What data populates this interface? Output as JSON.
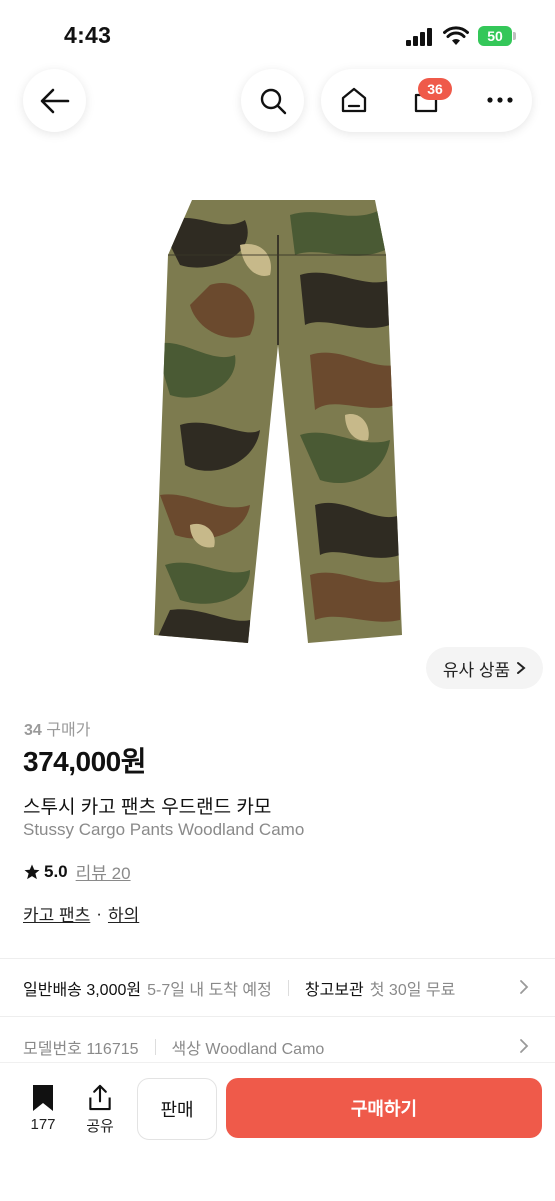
{
  "status_bar": {
    "time": "4:43",
    "battery": "50"
  },
  "nav": {
    "cart_count": "36"
  },
  "product": {
    "similar_label": "유사 상품",
    "purchase_count": "34",
    "purchase_suffix": "구매가",
    "price": "374,000원",
    "name_ko": "스투시 카고 팬츠 우드랜드 카모",
    "name_en": "Stussy Cargo Pants Woodland Camo",
    "rating": "5.0",
    "review_label": "리뷰 20",
    "category_1": "카고 팬츠",
    "category_sep": "·",
    "category_2": "하의"
  },
  "shipping": {
    "label": "일반배송 3,000원",
    "eta": "5-7일 내 도착 예정",
    "storage_label": "창고보관",
    "storage_offer": "첫 30일 무료"
  },
  "details": {
    "model": "모델번호 116715",
    "color": "색상 Woodland Camo"
  },
  "bottom_bar": {
    "bookmark_count": "177",
    "share_label": "공유",
    "sell_label": "판매",
    "buy_label": "구매하기"
  },
  "colors": {
    "accent": "#ef5a4a",
    "camo_base": "#7a7a4e",
    "camo_dark": "#2f2b22",
    "camo_brown": "#6b4a2e",
    "camo_green": "#4a5a34"
  }
}
